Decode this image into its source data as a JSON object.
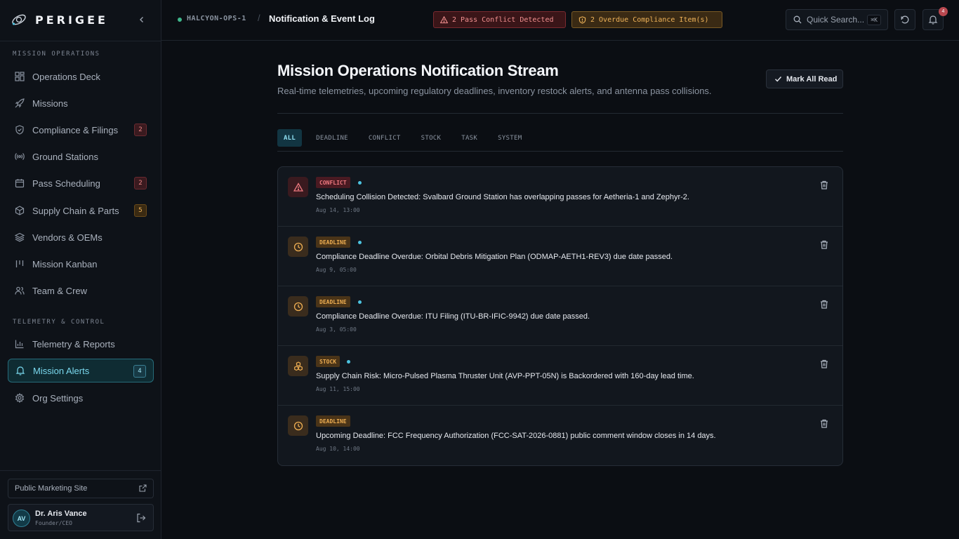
{
  "brand": {
    "name": "PERIGEE"
  },
  "sidebar": {
    "sections": [
      {
        "label": "MISSION OPERATIONS"
      },
      {
        "label": "TELEMETRY & CONTROL"
      }
    ],
    "items": [
      {
        "label": "Operations Deck",
        "icon": "grid-icon"
      },
      {
        "label": "Missions",
        "icon": "rocket-icon"
      },
      {
        "label": "Compliance & Filings",
        "icon": "shield-check-icon",
        "badge": "2"
      },
      {
        "label": "Ground Stations",
        "icon": "radio-signal-icon"
      },
      {
        "label": "Pass Scheduling",
        "icon": "calendar-icon",
        "badge": "2"
      },
      {
        "label": "Supply Chain & Parts",
        "icon": "package-icon",
        "badge": "5"
      },
      {
        "label": "Vendors & OEMs",
        "icon": "layers-icon"
      },
      {
        "label": "Mission Kanban",
        "icon": "kanban-icon"
      },
      {
        "label": "Team & Crew",
        "icon": "users-icon"
      },
      {
        "label": "Telemetry & Reports",
        "icon": "bar-chart-icon"
      },
      {
        "label": "Mission Alerts",
        "icon": "bell-icon",
        "badge": "4",
        "active": true
      },
      {
        "label": "Org Settings",
        "icon": "gear-icon"
      }
    ],
    "marketing_link": "Public Marketing Site",
    "user": {
      "initials": "AV",
      "name": "Dr. Aris Vance",
      "role": "Founder/CEO"
    }
  },
  "header": {
    "workspace": "HALCYON-OPS-1",
    "separator": "/",
    "page": "Notification & Event Log",
    "alerts": {
      "conflict": "2 Pass Conflict Detected",
      "compliance": "2 Overdue Compliance Item(s)"
    },
    "search": {
      "placeholder": "Quick Search...",
      "shortcut": "⌘K"
    },
    "notification_count": "4"
  },
  "main": {
    "title": "Mission Operations Notification Stream",
    "subtitle": "Real-time telemetries, upcoming regulatory deadlines, inventory restock alerts, and antenna pass collisions.",
    "mark_all_read": "Mark All Read",
    "tabs": [
      "ALL",
      "DEADLINE",
      "CONFLICT",
      "STOCK",
      "TASK",
      "SYSTEM"
    ],
    "active_tab": "ALL",
    "notifications": [
      {
        "type": "CONFLICT",
        "unread": true,
        "message": "Scheduling Collision Detected: Svalbard Ground Station has overlapping passes for Aetheria-1 and Zephyr-2.",
        "time": "Aug 14, 13:00"
      },
      {
        "type": "DEADLINE",
        "unread": true,
        "message": "Compliance Deadline Overdue: Orbital Debris Mitigation Plan (ODMAP-AETH1-REV3) due date passed.",
        "time": "Aug 9, 05:00"
      },
      {
        "type": "DEADLINE",
        "unread": true,
        "message": "Compliance Deadline Overdue: ITU Filing (ITU-BR-IFIC-9942) due date passed.",
        "time": "Aug 3, 05:00"
      },
      {
        "type": "STOCK",
        "unread": true,
        "message": "Supply Chain Risk: Micro-Pulsed Plasma Thruster Unit (AVP-PPT-05N) is Backordered with 160-day lead time.",
        "time": "Aug 11, 15:00"
      },
      {
        "type": "DEADLINE",
        "unread": false,
        "message": "Upcoming Deadline: FCC Frequency Authorization (FCC-SAT-2026-0881) public comment window closes in 14 days.",
        "time": "Aug 10, 14:00"
      }
    ]
  },
  "colors": {
    "accent": "#4cc3e0",
    "conflict": "#f07a80",
    "deadline": "#eeae52",
    "background": "#0b0e13"
  }
}
